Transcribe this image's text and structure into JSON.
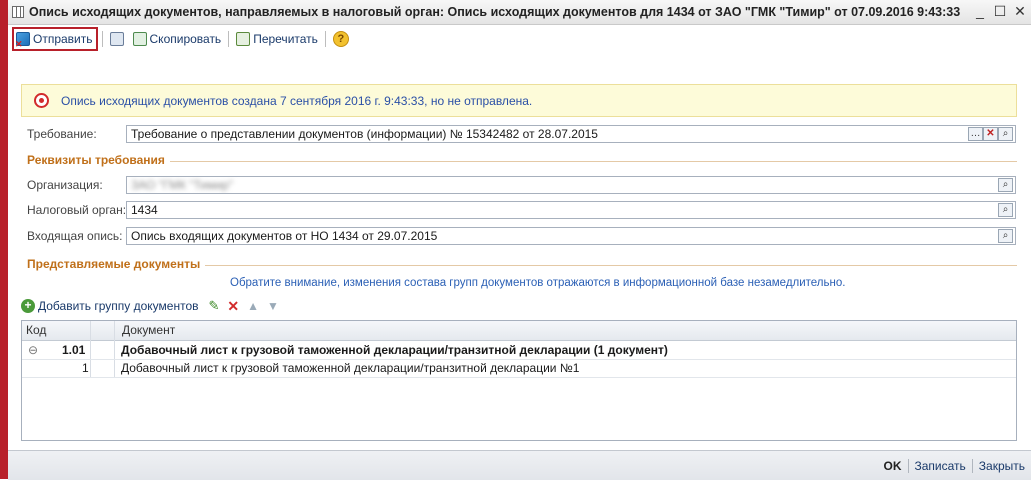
{
  "window": {
    "title": "Опись исходящих документов, направляемых в налоговый орган: Опись исходящих документов для 1434 от ЗАО \"ГМК \"Тимир\" от 07.09.2016 9:43:33",
    "minimize": "_",
    "maximize": "☐",
    "close": "✕"
  },
  "toolbar": {
    "send_label": "Отправить",
    "copy_label": "Скопировать",
    "reread_label": "Перечитать",
    "help_label": "?"
  },
  "notice": {
    "text": "Опись исходящих документов создана 7 сентября 2016 г. 9:43:33, но не отправлена."
  },
  "form": {
    "requirement_label": "Требование:",
    "requirement_value": "Требование о представлении документов (информации) № 15342482 от 28.07.2015",
    "section_requisites": "Реквизиты требования",
    "org_label": "Организация:",
    "org_value": "ЗАО \"ГМК \"Тимир\"",
    "tax_label": "Налоговый орган:",
    "tax_value": "1434",
    "incoming_label": "Входящая опись:",
    "incoming_value": "Опись входящих документов от НО 1434 от 29.07.2015",
    "section_docs": "Представляемые документы",
    "hint": "Обратите внимание, изменения состава групп документов отражаются в информационной базе незамедлительно.",
    "add_group_label": "Добавить группу документов"
  },
  "grid": {
    "col_code": "Код",
    "col_doc": "Документ",
    "rows": [
      {
        "toggle": "⊖",
        "code": "1.01",
        "doc": "Добавочный лист к грузовой таможенной декларации/транзитной декларации (1 документ)"
      },
      {
        "toggle": "",
        "code": "1",
        "doc": "Добавочный лист к грузовой таможенной декларации/транзитной декларации №1"
      }
    ]
  },
  "footer": {
    "ok": "OK",
    "save": "Записать",
    "close": "Закрыть"
  }
}
